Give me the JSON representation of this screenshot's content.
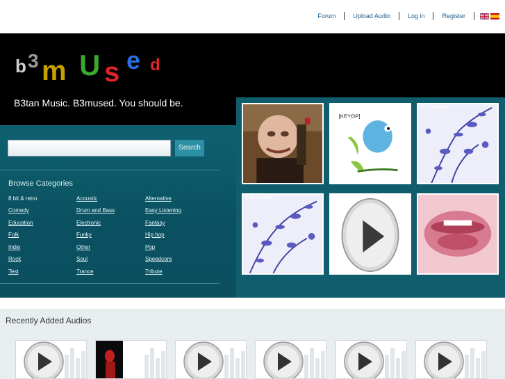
{
  "nav": {
    "links": [
      "Forum",
      "Upload Audio",
      "Log in",
      "Register"
    ],
    "languages": [
      "uk-flag-icon",
      "es-flag-icon"
    ]
  },
  "brand": {
    "letters": [
      "b",
      "3",
      "m",
      "U",
      "s",
      "e",
      "d"
    ],
    "colors": [
      "#cfcfcf",
      "#9a9a9a",
      "#c8a000",
      "#3aa82c",
      "#e0252a",
      "#2b6fe0",
      "#e0252a"
    ],
    "tagline": "B3tan Music. B3mused. You should be."
  },
  "search": {
    "placeholder": "",
    "button_label": "Search"
  },
  "browse": {
    "title": "Browse Categories",
    "categories": [
      [
        "8 bit & retro",
        "Acoustic",
        "Alternative"
      ],
      [
        "Comedy",
        "Drum and Bass",
        "Easy Listening"
      ],
      [
        "Education",
        "Electronic",
        "Fantasy"
      ],
      [
        "Folk",
        "Funky",
        "Hip hop"
      ],
      [
        "Indie",
        "Other",
        "Pop"
      ],
      [
        "Rock",
        "Soul",
        "Speedcore"
      ],
      [
        "Test",
        "Trance",
        "Tribute"
      ]
    ]
  },
  "featured": {
    "thumbs": [
      {
        "label": "",
        "kind": "old-man"
      },
      {
        "label": "[KEYOP]",
        "kind": "bird"
      },
      {
        "label": "Kids in Motto",
        "kind": "flowers"
      },
      {
        "label": "Kids in Motto",
        "kind": "flowers"
      },
      {
        "label": "",
        "kind": "play"
      },
      {
        "label": "",
        "kind": "lips"
      }
    ]
  },
  "recent": {
    "title": "Recently Added Audios",
    "items": [
      "play",
      "photo",
      "play",
      "play",
      "play",
      "play"
    ]
  },
  "colors": {
    "teal_dark": "#0b4f5f",
    "teal": "#0f5d6d",
    "link": "#1a5a8a"
  }
}
